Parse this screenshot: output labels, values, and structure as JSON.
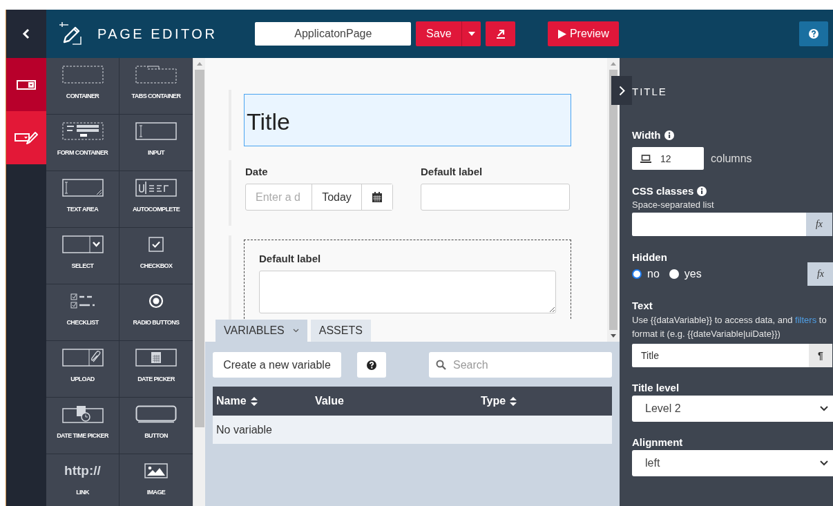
{
  "header": {
    "title": "PAGE EDITOR",
    "page_name": "ApplicatonPage",
    "save": "Save",
    "preview": "Preview"
  },
  "rail": [
    {
      "kind": "layout",
      "selected": true
    },
    {
      "kind": "widgets",
      "selected": false
    }
  ],
  "palette": [
    {
      "kind": "container",
      "label": "CONTAINER"
    },
    {
      "kind": "tabs",
      "label": "TABS CONTAINER"
    },
    {
      "kind": "form",
      "label": "FORM CONTAINER"
    },
    {
      "kind": "input",
      "label": "INPUT"
    },
    {
      "kind": "textarea",
      "label": "TEXT AREA"
    },
    {
      "kind": "autocomplete",
      "label": "AUTOCOMPLETE"
    },
    {
      "kind": "select",
      "label": "SELECT"
    },
    {
      "kind": "checkbox",
      "label": "CHECKBOX"
    },
    {
      "kind": "checklist",
      "label": "CHECKLIST"
    },
    {
      "kind": "radio",
      "label": "RADIO BUTTONS"
    },
    {
      "kind": "upload",
      "label": "UPLOAD"
    },
    {
      "kind": "datepicker",
      "label": "DATE PICKER"
    },
    {
      "kind": "datetime",
      "label": "DATE TIME PICKER"
    },
    {
      "kind": "button",
      "label": "BUTTON"
    },
    {
      "kind": "link",
      "label": "LINK",
      "icon_text": "http://"
    },
    {
      "kind": "image",
      "label": "IMAGE"
    }
  ],
  "canvas": {
    "title": "Title",
    "date": {
      "label": "Date",
      "placeholder": "Enter a d",
      "today": "Today"
    },
    "input": {
      "label": "Default label"
    },
    "textarea": {
      "label": "Default label"
    }
  },
  "bottom_tabs": [
    {
      "label": "VARIABLES",
      "selected": true,
      "caret": true
    },
    {
      "label": "ASSETS",
      "selected": false,
      "caret": false
    }
  ],
  "variables": {
    "create": "Create a new variable",
    "search_placeholder": "Search",
    "columns": [
      {
        "label": "Name",
        "sortable": true
      },
      {
        "label": "Value",
        "sortable": false
      },
      {
        "label": "Type",
        "sortable": true
      }
    ],
    "empty": "No variable"
  },
  "properties": {
    "heading": "TITLE",
    "width": {
      "label": "Width",
      "value": "12",
      "unit": "columns"
    },
    "css": {
      "label": "CSS classes",
      "hint": "Space-separated list",
      "fx": "fx"
    },
    "hidden": {
      "label": "Hidden",
      "fx": "fx",
      "options": [
        {
          "label": "no",
          "selected": true
        },
        {
          "label": "yes",
          "selected": false
        }
      ]
    },
    "text": {
      "label": "Text",
      "hint_before": "Use {{dataVariable}} to access data, and",
      "link": "filters",
      "hint_after": "to format it (e.g. {{dateVariable|uiDate}})",
      "value": "Title",
      "format": "¶"
    },
    "title_level": {
      "label": "Title level",
      "value": "Level 2"
    },
    "alignment": {
      "label": "Alignment",
      "value": "left"
    }
  }
}
